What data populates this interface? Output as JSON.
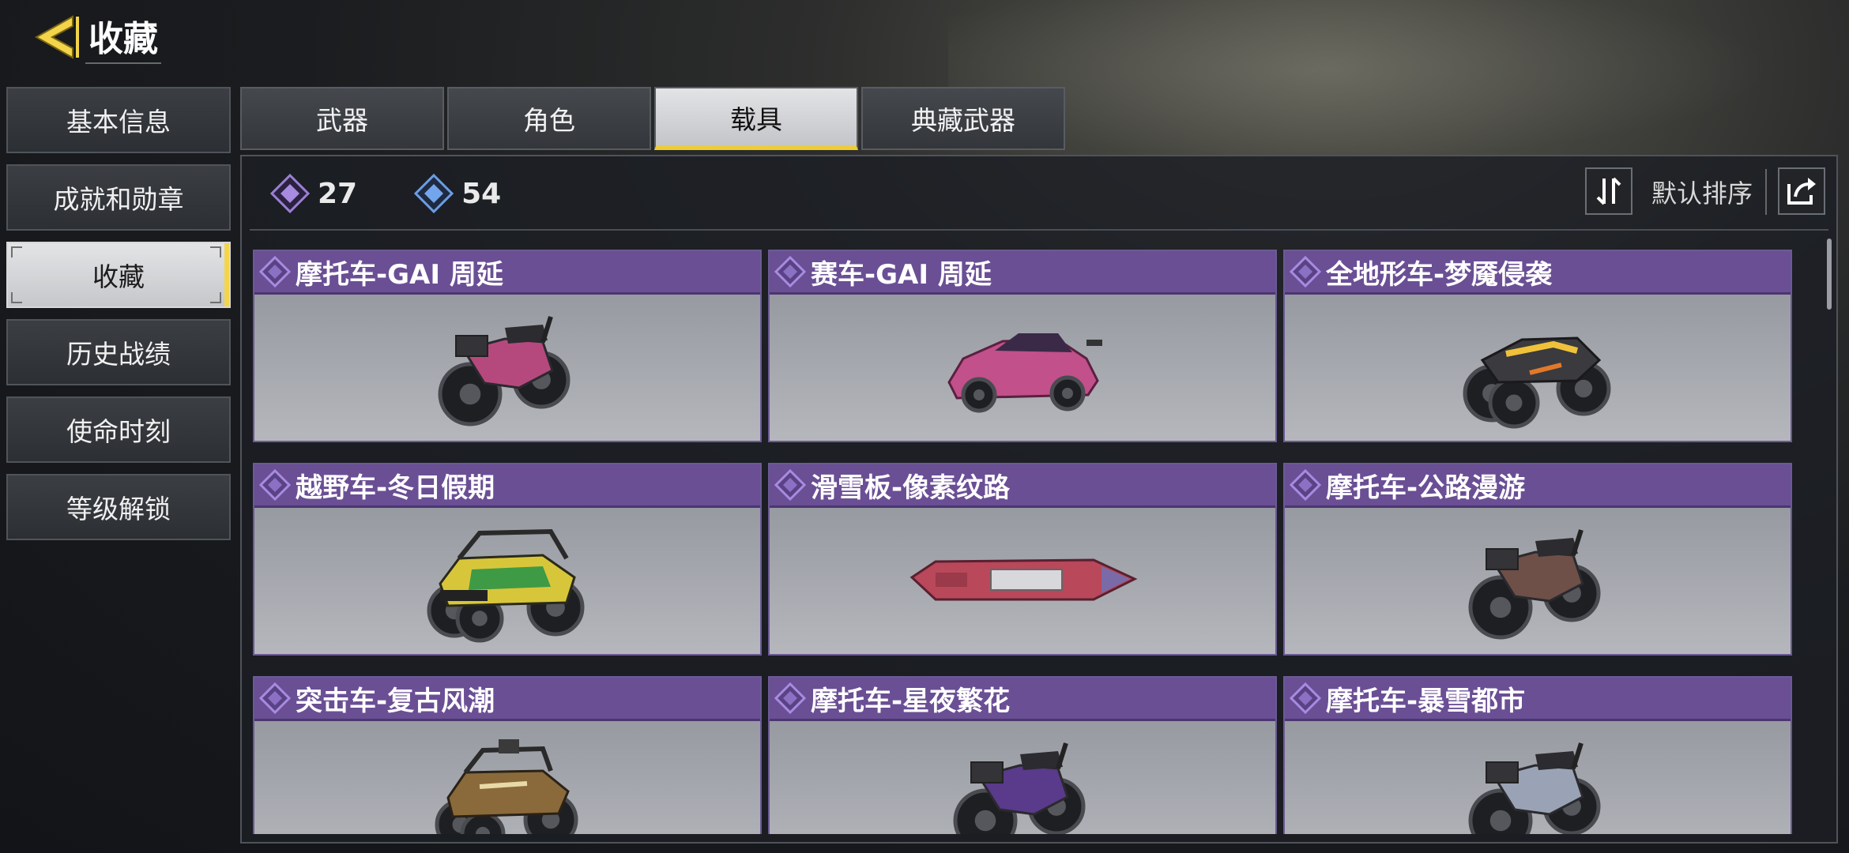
{
  "header": {
    "title": "收藏",
    "back_icon": "back-arrow-icon"
  },
  "sidebar": {
    "items": [
      {
        "label": "基本信息",
        "active": false
      },
      {
        "label": "成就和勋章",
        "active": false
      },
      {
        "label": "收藏",
        "active": true
      },
      {
        "label": "历史战绩",
        "active": false
      },
      {
        "label": "使命时刻",
        "active": false
      },
      {
        "label": "等级解锁",
        "active": false
      }
    ]
  },
  "tabs": [
    {
      "label": "武器",
      "active": false
    },
    {
      "label": "角色",
      "active": false
    },
    {
      "label": "载具",
      "active": true
    },
    {
      "label": "典藏武器",
      "active": false
    }
  ],
  "stats": {
    "epic_count": "27",
    "rare_count": "54",
    "epic_icon": "purple-diamond-icon",
    "rare_icon": "blue-diamond-icon"
  },
  "toolbar": {
    "sort_icon": "sort-arrows-icon",
    "sort_label": "默认排序",
    "share_icon": "share-icon"
  },
  "colors": {
    "accent": "#f0cc2e",
    "epic": "#6a4f95",
    "rare": "#5a8fd6"
  },
  "items": [
    {
      "name": "摩托车-GAI 周延",
      "vehicle": "motorcycle",
      "color": "#b5497e"
    },
    {
      "name": "赛车-GAI 周延",
      "vehicle": "race-car",
      "color": "#c2508a"
    },
    {
      "name": "全地形车-梦魇侵袭",
      "vehicle": "atv",
      "color": "#3a3a3f"
    },
    {
      "name": "越野车-冬日假期",
      "vehicle": "offroad-buggy",
      "color": "#3f9a45"
    },
    {
      "name": "滑雪板-像素纹路",
      "vehicle": "snowboard",
      "color": "#b8485a"
    },
    {
      "name": "摩托车-公路漫游",
      "vehicle": "motorcycle",
      "color": "#6e5048"
    },
    {
      "name": "突击车-复古风潮",
      "vehicle": "assault-buggy",
      "color": "#8a6a3a"
    },
    {
      "name": "摩托车-星夜繁花",
      "vehicle": "motorcycle",
      "color": "#5a3a8a"
    },
    {
      "name": "摩托车-暴雪都市",
      "vehicle": "motorcycle",
      "color": "#9aa3b5"
    }
  ]
}
